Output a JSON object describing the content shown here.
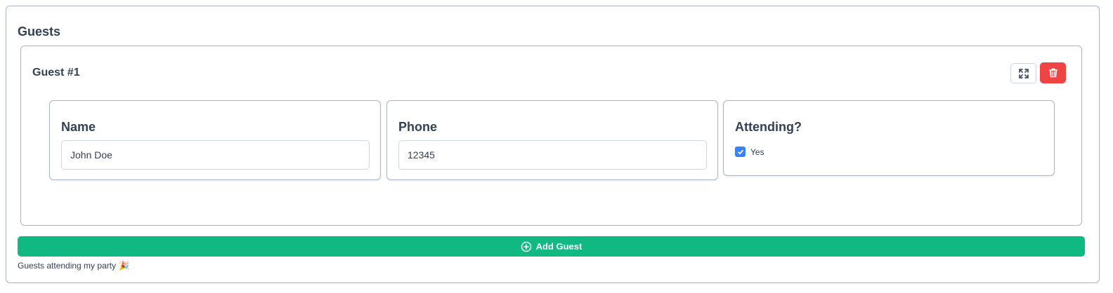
{
  "section": {
    "title": "Guests"
  },
  "guest": {
    "title": "Guest #1",
    "expand_icon": "expand-icon",
    "delete_icon": "trash-icon",
    "fields": {
      "name": {
        "label": "Name",
        "value": "John Doe"
      },
      "phone": {
        "label": "Phone",
        "value": "12345"
      },
      "attending": {
        "label": "Attending?",
        "checkbox_label": "Yes",
        "checked": true
      }
    }
  },
  "actions": {
    "add_label": "Add Guest",
    "add_icon": "plus-circle-icon"
  },
  "helper": {
    "text": "Guests attending my party",
    "emoji": "🎉"
  },
  "colors": {
    "danger": "#ef4444",
    "success": "#10b981",
    "primary": "#3b82f6",
    "border": "#a9b4c4"
  }
}
